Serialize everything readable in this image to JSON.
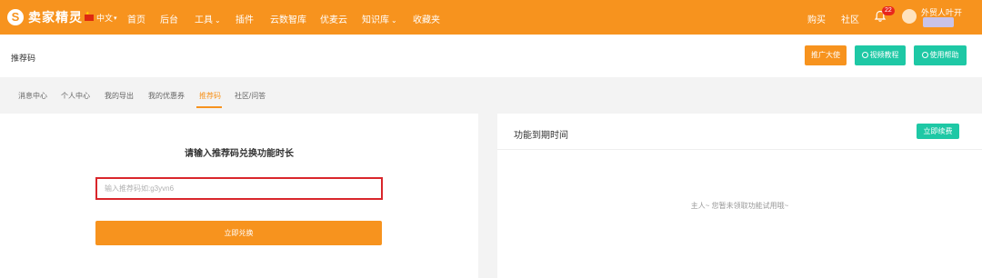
{
  "brand": {
    "logo_letter": "S",
    "name": "卖家精灵"
  },
  "colors": {
    "primary": "#f7931e",
    "accent": "#1ec8a5",
    "badge": "#e8251c",
    "error": "#d9262b"
  },
  "topnav": {
    "language": "中文",
    "items": [
      {
        "label": "首页",
        "dropdown": false
      },
      {
        "label": "后台",
        "dropdown": false
      },
      {
        "label": "工具",
        "dropdown": true
      },
      {
        "label": "插件",
        "dropdown": false
      },
      {
        "label": "云数智库",
        "dropdown": false
      },
      {
        "label": "优麦云",
        "dropdown": false
      },
      {
        "label": "知识库",
        "dropdown": true
      },
      {
        "label": "收藏夹",
        "dropdown": false
      }
    ],
    "right": {
      "buy": "购买",
      "community": "社区",
      "notification_count": "22",
      "username": "外贸人叶开"
    }
  },
  "header": {
    "title": "推荐码",
    "buttons": {
      "promo": "推广大使",
      "video": "视频教程",
      "help": "使用帮助"
    }
  },
  "tabs": [
    {
      "label": "消息中心",
      "active": false
    },
    {
      "label": "个人中心",
      "active": false
    },
    {
      "label": "我的导出",
      "active": false
    },
    {
      "label": "我的优惠券",
      "active": false
    },
    {
      "label": "推荐码",
      "active": true
    },
    {
      "label": "社区/问答",
      "active": false
    }
  ],
  "exchange": {
    "title": "请输入推荐码兑换功能时长",
    "input_placeholder": "输入推荐码如:g3yvn6",
    "input_value": "",
    "submit_label": "立即兑换"
  },
  "expiry": {
    "title": "功能到期时间",
    "renew_label": "立即续费",
    "empty_message": "主人~ 您暂未领取功能试用哦~"
  }
}
